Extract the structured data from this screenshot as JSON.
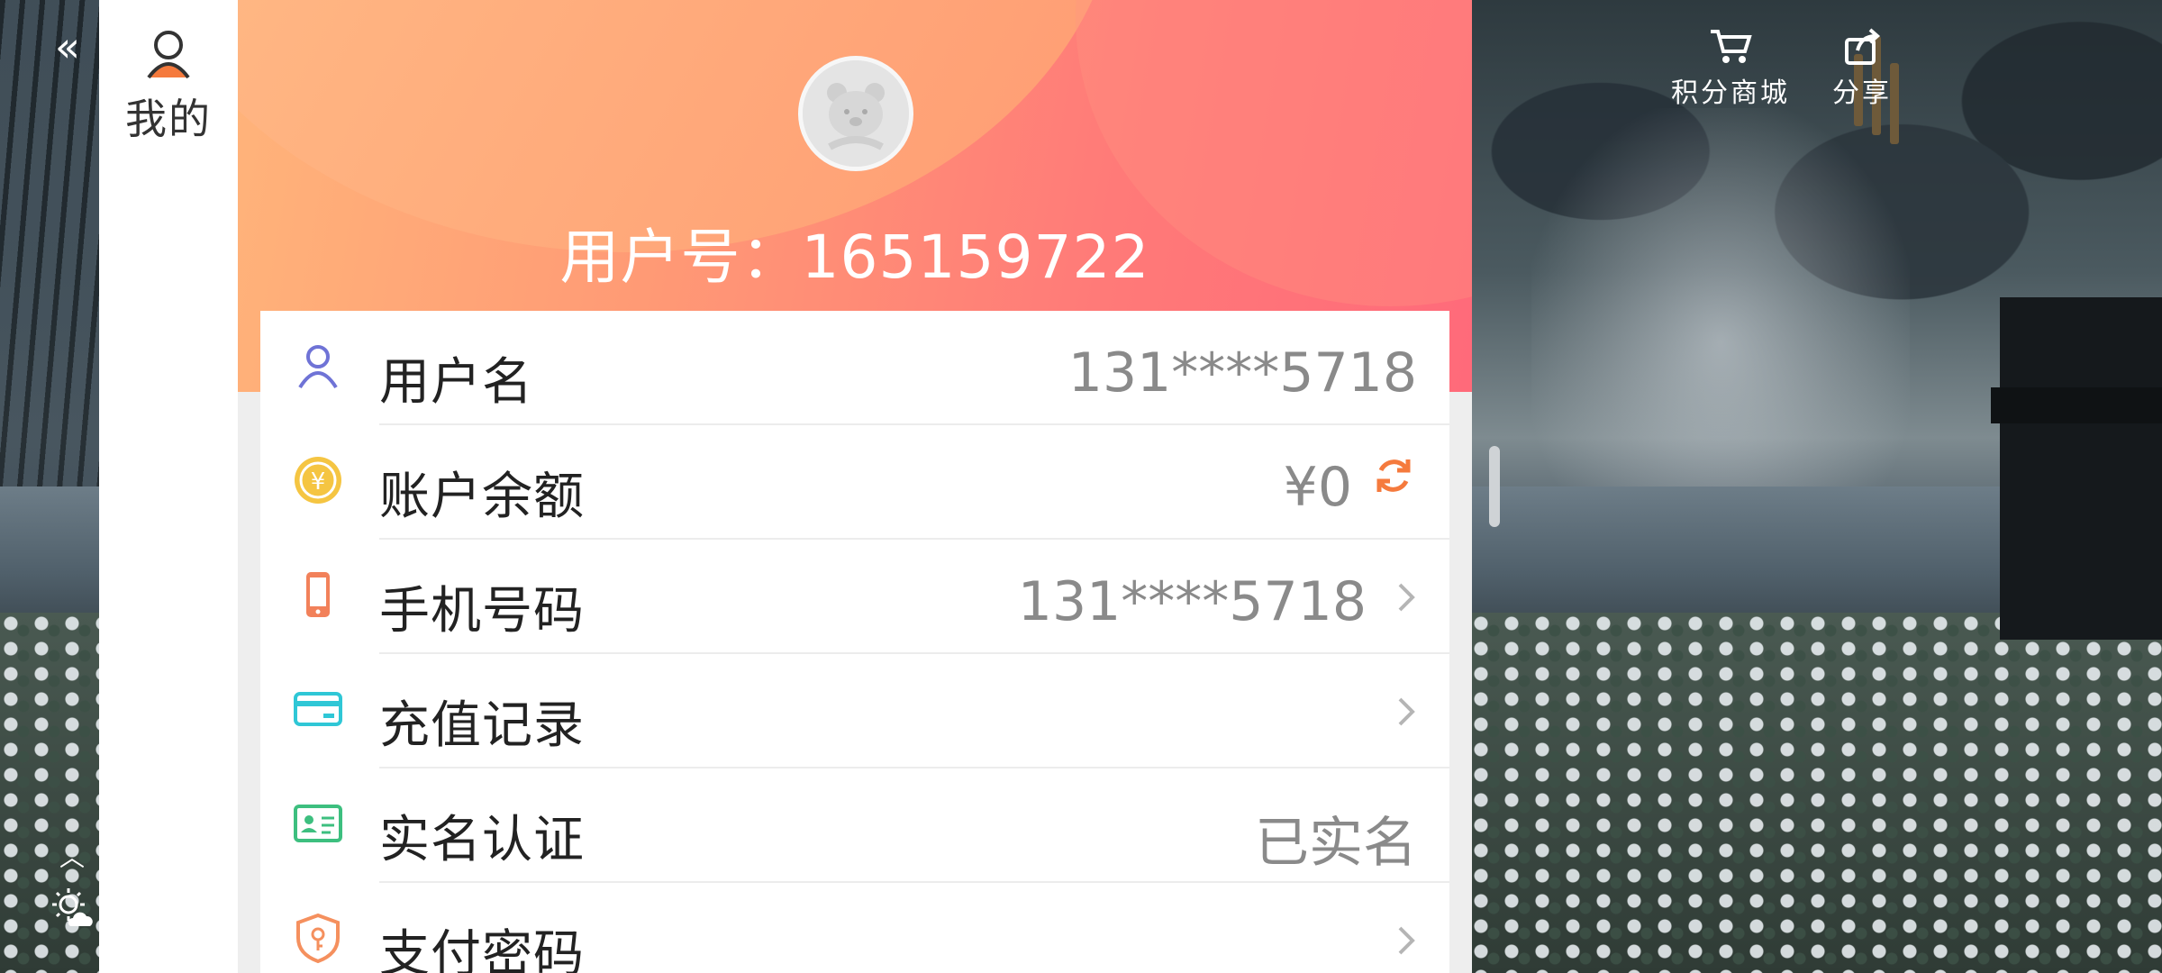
{
  "left_rail": {
    "back_glyph": "«",
    "tab_label": "我的",
    "tab_icon": "user-icon"
  },
  "header": {
    "user_no": "用户号：165159722"
  },
  "rows": [
    {
      "id": "username",
      "icon": "person-icon",
      "label": "用户名",
      "value": "131****5718",
      "chevron": false
    },
    {
      "id": "balance",
      "icon": "coin-icon",
      "label": "账户余额",
      "value": "¥0",
      "chevron": false,
      "refresh": true
    },
    {
      "id": "phone",
      "icon": "phone-icon",
      "label": "手机号码",
      "value": "131****5718",
      "chevron": true
    },
    {
      "id": "recharge",
      "icon": "card-icon",
      "label": "充值记录",
      "value": "",
      "chevron": true
    },
    {
      "id": "realname",
      "icon": "id-card-icon",
      "label": "实名认证",
      "value": "已实名",
      "chevron": false
    },
    {
      "id": "paypwd",
      "icon": "shield-key-icon",
      "label": "支付密码",
      "value": "",
      "chevron": true
    }
  ],
  "top_tools": {
    "mall": {
      "label": "积分商城",
      "icon": "cart-icon"
    },
    "share": {
      "label": "分享",
      "icon": "share-icon"
    }
  },
  "colors": {
    "header_start": "#ffb47a",
    "header_end": "#ff6a7a",
    "accent_orange": "#f57a3d",
    "coin": "#f5c542",
    "card_icon": "#2fc7d6",
    "id_icon": "#3dbf7f",
    "person_icon": "#6f73d6"
  }
}
